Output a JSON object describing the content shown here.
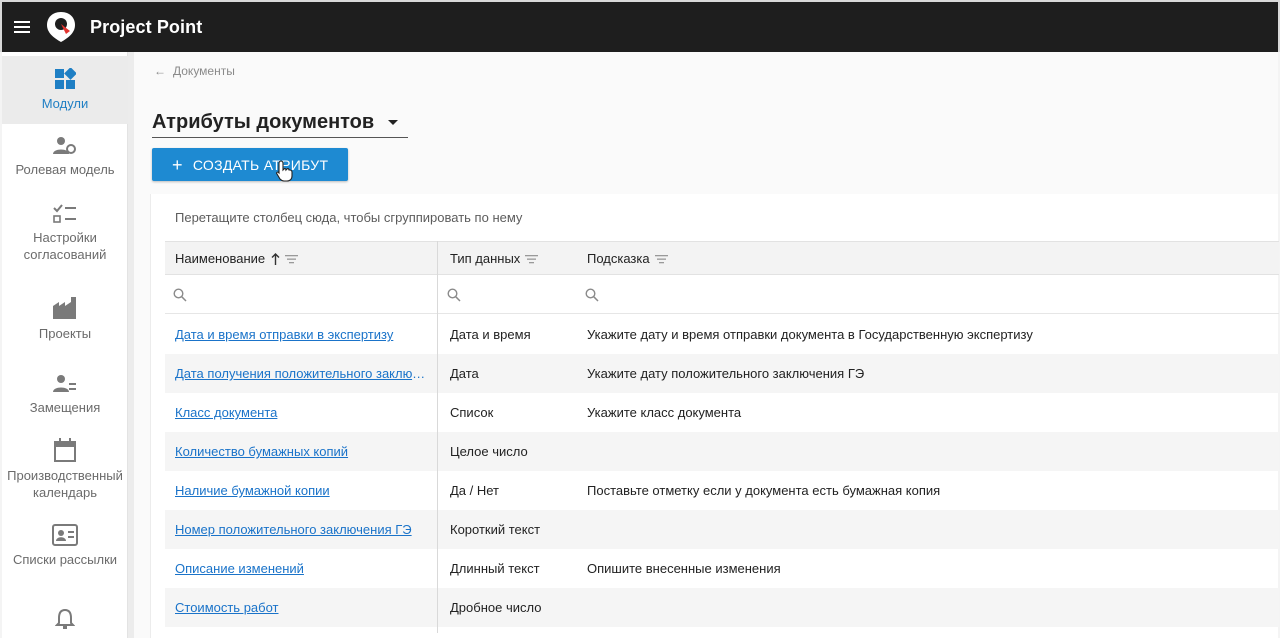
{
  "app": {
    "name": "Project Point"
  },
  "sidebar": {
    "items": [
      {
        "label": "Модули",
        "icon": "modules-icon"
      },
      {
        "label": "Ролевая модель",
        "icon": "user-gear-icon"
      },
      {
        "label": "Настройки согласований",
        "icon": "checklist-icon"
      },
      {
        "label": "Проекты",
        "icon": "factory-icon"
      },
      {
        "label": "Замещения",
        "icon": "user-swap-icon"
      },
      {
        "label": "Производственный календарь",
        "icon": "calendar-icon"
      },
      {
        "label": "Списки рассылки",
        "icon": "contact-card-icon"
      },
      {
        "label": "",
        "icon": "bell-icon"
      }
    ]
  },
  "breadcrumb": {
    "label": "Документы"
  },
  "page": {
    "title": "Атрибуты документов"
  },
  "toolbar": {
    "create_label": "СОЗДАТЬ АТРИБУТ"
  },
  "grid": {
    "group_hint": "Перетащите столбец сюда, чтобы сгруппировать по нему",
    "columns": [
      {
        "label": "Наименование"
      },
      {
        "label": "Тип данных"
      },
      {
        "label": "Подсказка"
      }
    ],
    "rows": [
      {
        "name": "Дата и время отправки в экспертизу",
        "type": "Дата и время",
        "hint": "Укажите дату и время отправки документа в Государственную экспертизу"
      },
      {
        "name": "Дата получения положительного заключения ГЭ",
        "type": "Дата",
        "hint": "Укажите дату положительного заключения ГЭ"
      },
      {
        "name": "Класс документа",
        "type": "Список",
        "hint": "Укажите класс документа"
      },
      {
        "name": "Количество бумажных копий",
        "type": "Целое число",
        "hint": ""
      },
      {
        "name": "Наличие бумажной копии",
        "type": "Да / Нет",
        "hint": "Поставьте отметку если у документа есть бумажная копия"
      },
      {
        "name": "Номер положительного заключения ГЭ",
        "type": "Короткий текст",
        "hint": ""
      },
      {
        "name": "Описание изменений",
        "type": "Длинный текст",
        "hint": "Опишите внесенные изменения"
      },
      {
        "name": "Стоимость работ",
        "type": "Дробное число",
        "hint": ""
      }
    ]
  },
  "colors": {
    "accent": "#1e8ad2",
    "link": "#1a73c9",
    "topbar": "#1e1e1e",
    "active_nav": "#1f7fc4"
  }
}
